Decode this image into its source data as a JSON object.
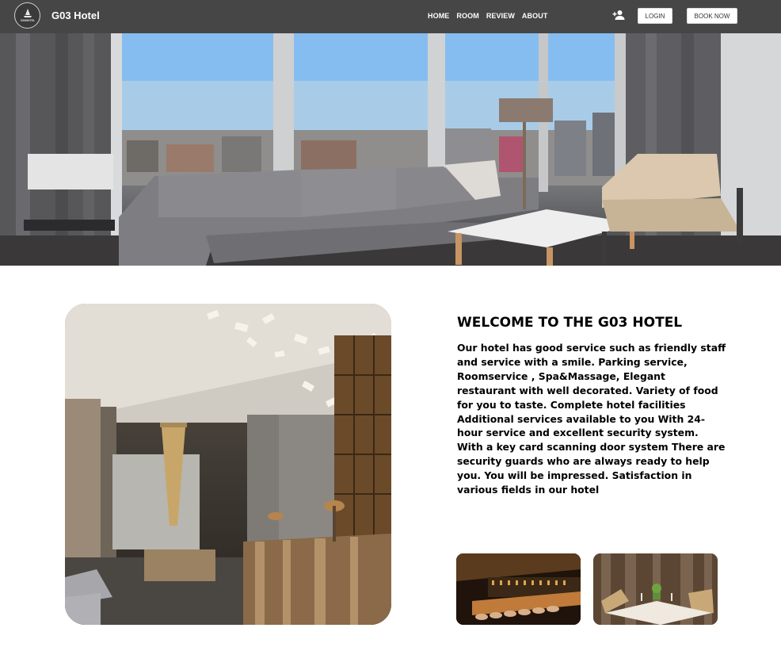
{
  "navbar": {
    "logo_text": "G03HOTEL",
    "brand": "G03 Hotel",
    "links": [
      "HOME",
      "ROOM",
      "REVIEW",
      "ABOUT"
    ],
    "login_label": "LOGIN",
    "book_label": "BOOK NOW"
  },
  "icons": {
    "logo": "hotel-logo-icon",
    "user_add": "person-add-icon"
  },
  "colors": {
    "navbar_bg": "#464646",
    "page_bg": "#ffffff",
    "text": "#000000"
  },
  "welcome": {
    "title": "WELCOME TO THE G03 HOTEL",
    "body": "Our hotel has good service such as friendly staff and service with a smile. Parking service, Roomservice , Spa&Massage, Elegant restaurant with well decorated. Variety of food for you to taste. Complete hotel facilities Additional services available to you With 24-hour service and excellent security system. With a key card scanning door system There are security guards who are always ready to help you. You will be impressed. Satisfaction in various fields in our hotel"
  }
}
